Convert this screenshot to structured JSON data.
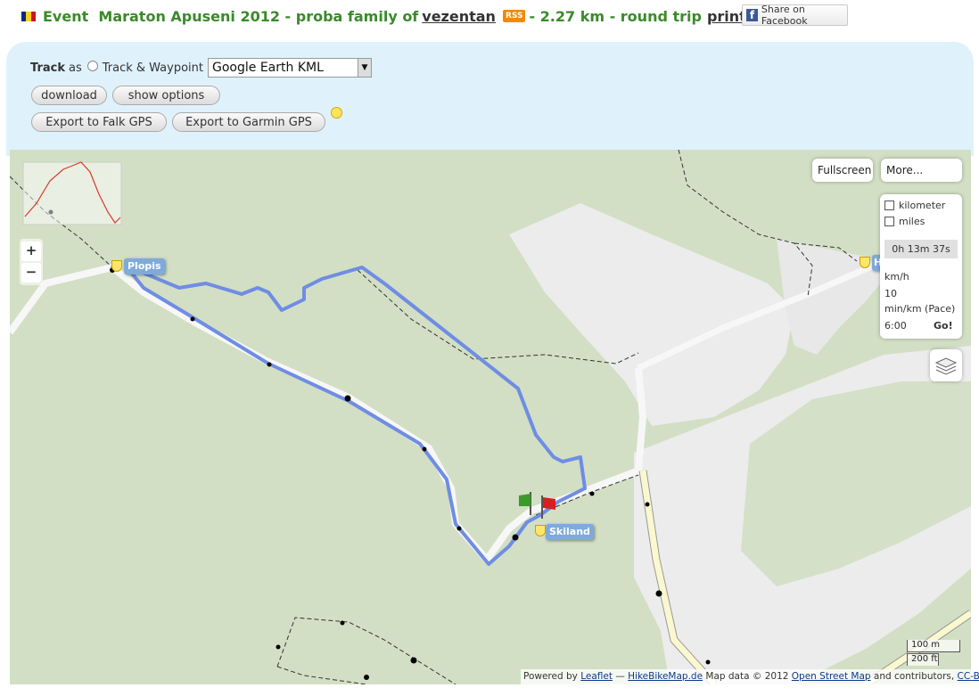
{
  "header": {
    "flag_colors": [
      "#002b7f",
      "#fcd116",
      "#ce1126"
    ],
    "prefix": "Event",
    "event_name": "Maraton Apuseni 2012 - proba family of",
    "user": "vezentan",
    "rss": "RSS",
    "distance": "- 2.27 km - round trip",
    "print": "print",
    "facebook": "Share on Facebook"
  },
  "export": {
    "track_label": "Track",
    "as_label": "as",
    "radio_label": "Track & Waypoint",
    "format_selected": "Google Earth KML",
    "download": "download",
    "show_options": "show options",
    "falk": "Export to Falk GPS",
    "garmin": "Export to Garmin GPS"
  },
  "map": {
    "zoom_in": "+",
    "zoom_out": "−",
    "fullscreen": "Fullscreen",
    "more": "More...",
    "units": {
      "kilometer": "kilometer",
      "miles": "miles"
    },
    "duration": "0h 13m 37s",
    "kmh_label": "km/h",
    "kmh_value": "10",
    "pace_label": "min/km (Pace)",
    "pace_value": "6:00",
    "go": "Go!",
    "poi": {
      "plopis": "Plopis",
      "skiland": "Skiland",
      "edge": "H"
    },
    "scale": {
      "metric": "100 m",
      "imperial": "200 ft"
    },
    "attribution": {
      "powered": "Powered by",
      "leaflet": "Leaflet",
      "dash": "—",
      "hbm": "HikeBikeMap.de",
      "mapdata": "Map data © 2012",
      "osm": "Open Street Map",
      "and": "and contributors,",
      "license": "CC-BY-SA"
    },
    "route_color": "#6f8de4"
  }
}
